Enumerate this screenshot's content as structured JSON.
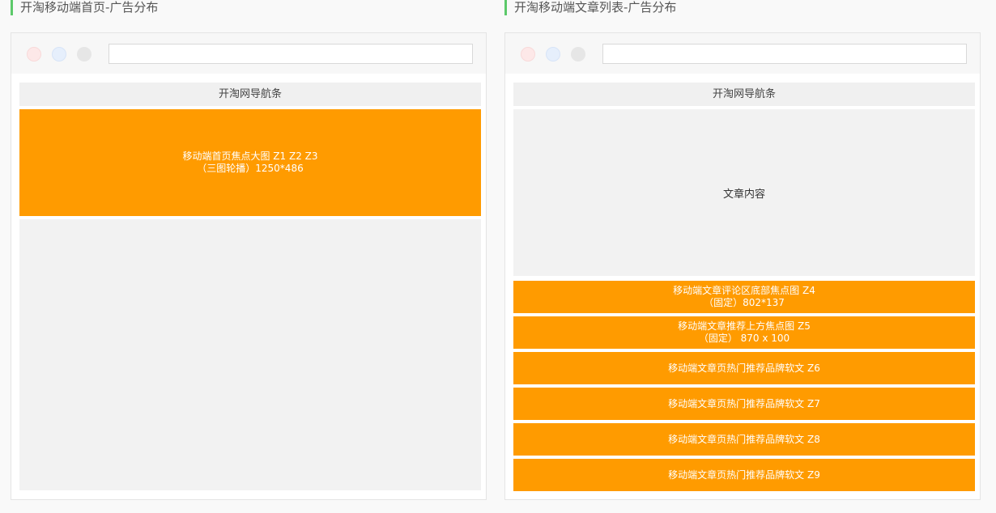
{
  "left_panel": {
    "title": "开淘移动端首页-广告分布",
    "nav_label": "开淘网导航条",
    "ad": {
      "line1": "移动端首页焦点大图 Z1  Z2  Z3",
      "line2": "（三图轮播）1250*486"
    }
  },
  "right_panel": {
    "title": "开淘移动端文章列表-广告分布",
    "nav_label": "开淘网导航条",
    "content_label": "文章内容",
    "ads": [
      {
        "line1": "移动端文章评论区底部焦点图 Z4",
        "line2": "（固定）802*137"
      },
      {
        "line1": "移动端文章推荐上方焦点图 Z5",
        "line2": "（固定） 870 x 100"
      },
      {
        "line1": "移动端文章页热门推荐品牌软文 Z6",
        "line2": ""
      },
      {
        "line1": "移动端文章页热门推荐品牌软文 Z7",
        "line2": ""
      },
      {
        "line1": "移动端文章页热门推荐品牌软文 Z8",
        "line2": ""
      },
      {
        "line1": "移动端文章页热门推荐品牌软文 Z9",
        "line2": ""
      }
    ]
  },
  "colors": {
    "accent_green": "#5cc96a",
    "ad_orange": "#ff9b00",
    "placeholder_gray": "#f2f2f2"
  }
}
